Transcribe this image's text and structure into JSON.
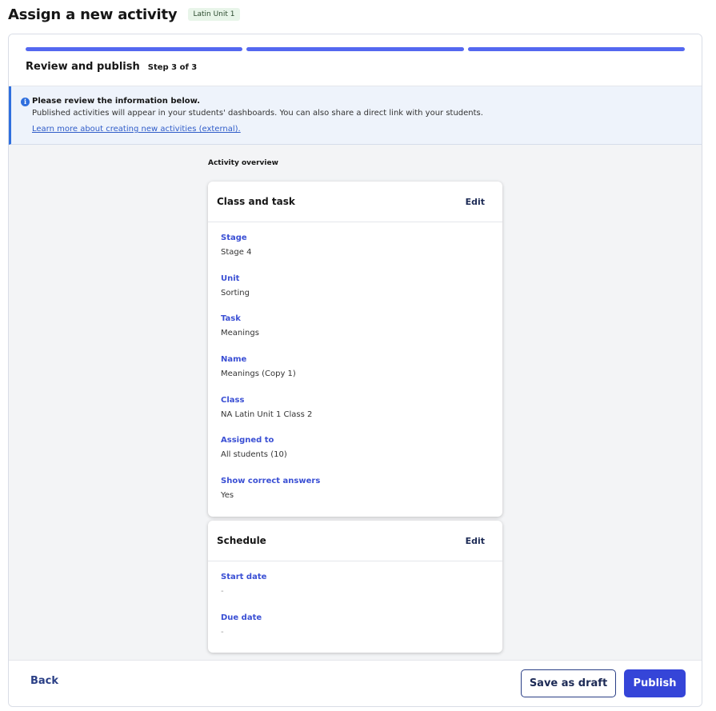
{
  "header": {
    "title": "Assign a new activity",
    "badge": "Latin Unit 1"
  },
  "stepper": {
    "steps_total": 3,
    "steps_completed": 3,
    "title": "Review and publish",
    "step_label": "Step 3 of 3"
  },
  "info": {
    "icon": "info-icon",
    "title": "Please review the information below.",
    "text": "Published activities will appear in your students' dashboards. You can also share a direct link with your students.",
    "link": "Learn more about creating new activities (external)."
  },
  "overview": {
    "label": "Activity overview",
    "class_task": {
      "title": "Class and task",
      "edit_label": "Edit",
      "fields": [
        {
          "label": "Stage",
          "value": "Stage 4"
        },
        {
          "label": "Unit",
          "value": "Sorting"
        },
        {
          "label": "Task",
          "value": "Meanings"
        },
        {
          "label": "Name",
          "value": "Meanings (Copy 1)"
        },
        {
          "label": "Class",
          "value": "NA Latin Unit 1 Class 2"
        },
        {
          "label": "Assigned to",
          "value": "All students (10)"
        },
        {
          "label": "Show correct answers",
          "value": "Yes"
        }
      ]
    },
    "schedule": {
      "title": "Schedule",
      "edit_label": "Edit",
      "fields": [
        {
          "label": "Start date",
          "value": "-"
        },
        {
          "label": "Due date",
          "value": "-"
        }
      ]
    }
  },
  "footer": {
    "back_label": "Back",
    "draft_label": "Save as draft",
    "publish_label": "Publish"
  },
  "colors": {
    "accent": "#5468f0",
    "primary_button": "#3545d8",
    "field_label": "#3a4fd4",
    "info_border": "#2f6fde"
  }
}
